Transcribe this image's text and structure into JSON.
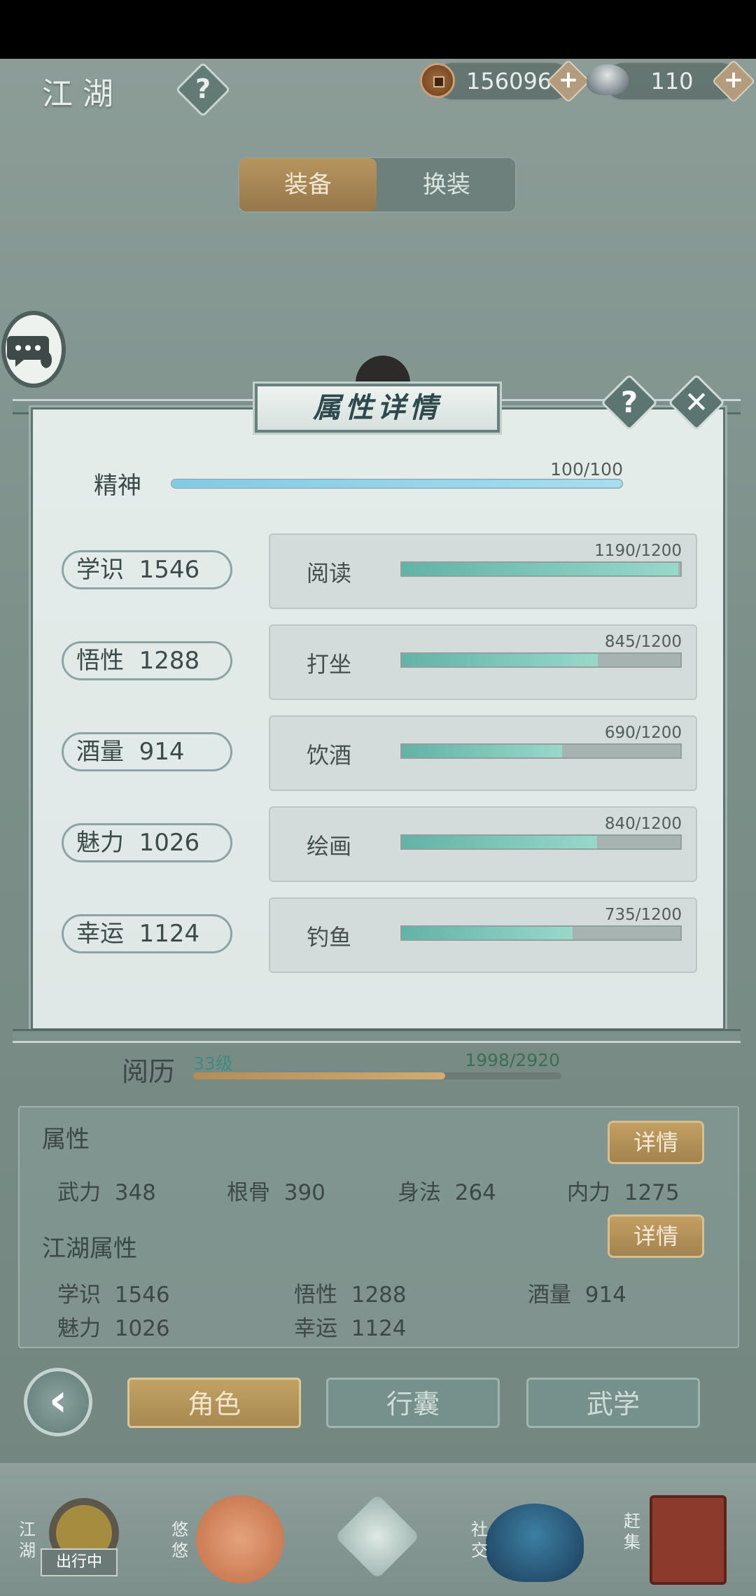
{
  "header": {
    "title": "江湖",
    "help_glyph": "?",
    "copper": "156096",
    "silver": "110",
    "plus_glyph": "+"
  },
  "tabs": [
    {
      "label": "装备",
      "active": true
    },
    {
      "label": "换装",
      "active": false
    }
  ],
  "modal": {
    "title": "属性详情",
    "help_glyph": "?",
    "close_glyph": "✕",
    "spirit": {
      "label": "精神",
      "value_text": "100/100",
      "fraction": 1.0
    },
    "attributes": [
      {
        "label": "学识",
        "value": "1546",
        "activity": "阅读",
        "progress_text": "1190/1200",
        "fraction": 0.992
      },
      {
        "label": "悟性",
        "value": "1288",
        "activity": "打坐",
        "progress_text": "845/1200",
        "fraction": 0.704
      },
      {
        "label": "酒量",
        "value": "914",
        "activity": "饮酒",
        "progress_text": "690/1200",
        "fraction": 0.575
      },
      {
        "label": "魅力",
        "value": "1026",
        "activity": "绘画",
        "progress_text": "840/1200",
        "fraction": 0.7
      },
      {
        "label": "幸运",
        "value": "1124",
        "activity": "钓鱼",
        "progress_text": "735/1200",
        "fraction": 0.6125
      }
    ]
  },
  "experience": {
    "label": "阅历",
    "level": "33级",
    "value_text": "1998/2920",
    "fraction": 0.684
  },
  "attributes_panel": {
    "title": "属性",
    "detail_label": "详情",
    "stats": [
      {
        "label": "武力",
        "value": "348"
      },
      {
        "label": "根骨",
        "value": "390"
      },
      {
        "label": "身法",
        "value": "264"
      },
      {
        "label": "内力",
        "value": "1275"
      }
    ]
  },
  "jianghu_panel": {
    "title": "江湖属性",
    "detail_label": "详情",
    "stats": [
      {
        "label": "学识",
        "value": "1546"
      },
      {
        "label": "悟性",
        "value": "1288"
      },
      {
        "label": "酒量",
        "value": "914"
      },
      {
        "label": "魅力",
        "value": "1026"
      },
      {
        "label": "幸运",
        "value": "1124"
      }
    ]
  },
  "bottom_tabs": [
    {
      "label": "角色",
      "active": true
    },
    {
      "label": "行囊",
      "active": false
    },
    {
      "label": "武学",
      "active": false
    }
  ],
  "bottom_nav": {
    "jianghu": "江湖",
    "traveling": "出行中",
    "youyou": "悠悠",
    "social": "社交",
    "market": "赶集"
  },
  "colors": {
    "accent_gold": "#b7955f",
    "progress_teal": "#62b3a6",
    "spirit_blue": "#7fcbe5"
  },
  "icons": [
    "help-icon",
    "copper-coin-icon",
    "silver-ingot-icon",
    "plus-icon",
    "chat-icon",
    "close-icon",
    "back-icon"
  ]
}
